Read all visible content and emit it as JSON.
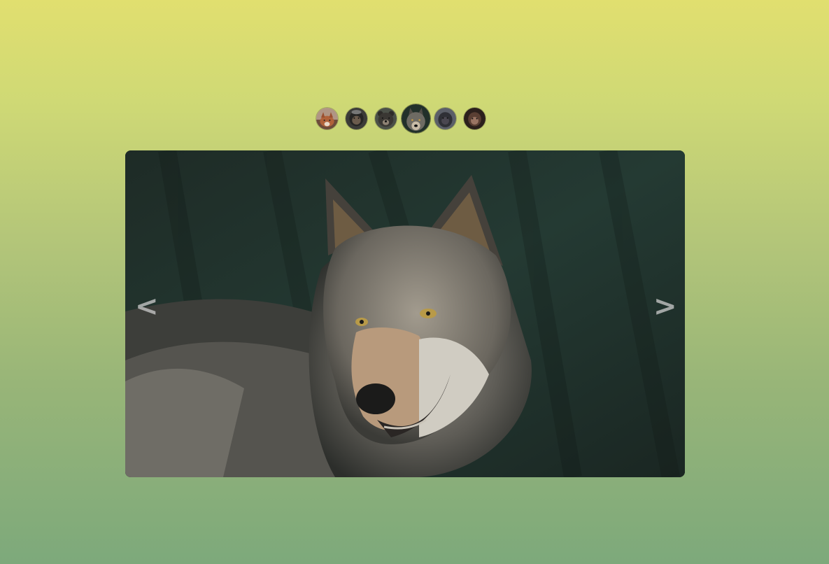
{
  "gallery": {
    "nav": {
      "prev_label": "<",
      "next_label": ">"
    },
    "thumbnails": [
      {
        "animal": "fox",
        "active": false
      },
      {
        "animal": "chimpanzee",
        "active": false
      },
      {
        "animal": "bear",
        "active": false
      },
      {
        "animal": "wolf",
        "active": true
      },
      {
        "animal": "gorilla",
        "active": false
      },
      {
        "animal": "monkey",
        "active": false
      }
    ],
    "current_slide": {
      "animal": "wolf",
      "index": 4,
      "total": 6
    }
  },
  "colors": {
    "background_top": "#e1df6f",
    "background_bottom": "#7da97b",
    "nav_arrow": "#c8c8c8"
  }
}
